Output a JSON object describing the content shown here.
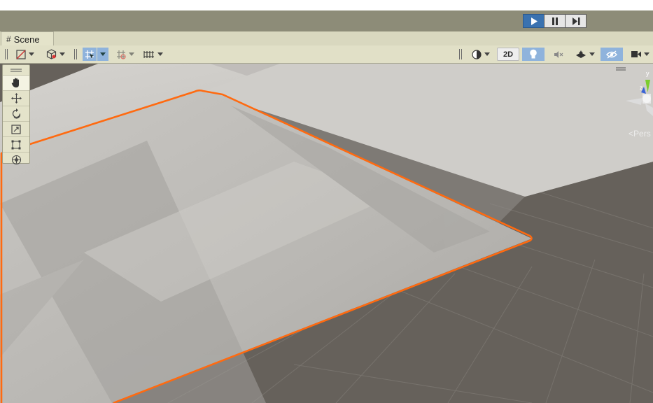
{
  "toolbar_play": {
    "play_icon": "play-icon",
    "pause_icon": "pause-icon",
    "step_icon": "step-icon"
  },
  "tab": {
    "label": "Scene",
    "icon": "hash-icon"
  },
  "scene_toolbar": {
    "draw_mode_icon": "shading-mode-icon",
    "effects_icon": "render-mode-icon",
    "grid_snap_icon": "grid-snap-icon",
    "increment_snap_icon": "increment-snap-icon",
    "grid_icon": "grid-icon",
    "shading_icon": "shading-circle-icon",
    "two_d_label": "2D",
    "lighting_icon": "lightbulb-icon",
    "audio_icon": "audio-mute-icon",
    "effects_toggle_icon": "effects-icon",
    "visibility_icon": "hidden-eye-icon",
    "camera_icon": "camera-icon",
    "colors": {
      "selected": "#8fb3dc",
      "play_active": "#3a72b0"
    }
  },
  "tools": [
    "hand-tool",
    "move-tool",
    "rotate-tool",
    "scale-tool",
    "rect-tool",
    "transform-tool"
  ],
  "gizmo": {
    "y_label": "y",
    "z_label": "z",
    "projection_label": "Pers"
  },
  "scene": {
    "selection_outline_color": "#ff6a10"
  }
}
